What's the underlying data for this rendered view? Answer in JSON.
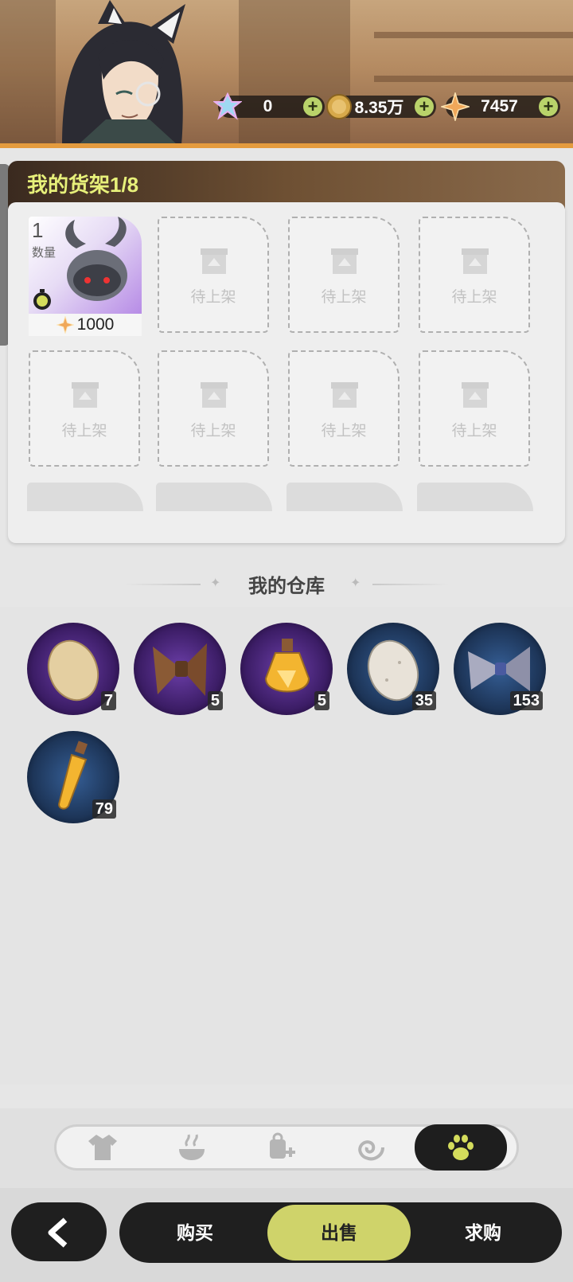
{
  "header": {
    "currencies": [
      {
        "icon": "crystal-icon",
        "value": "0"
      },
      {
        "icon": "gold-coin-icon",
        "value": "8.35万"
      },
      {
        "icon": "star-shard-icon",
        "value": "7457"
      }
    ],
    "plus_label": "+"
  },
  "shelf": {
    "title": "我的货架1/8",
    "listed_item": {
      "quantity": "1",
      "quantity_label": "数量",
      "price": "1000",
      "price_icon": "star-shard-icon"
    },
    "empty_slot_label": "待上架"
  },
  "warehouse": {
    "title": "我的仓库",
    "items": [
      {
        "icon": "egg-icon",
        "count": "7",
        "rarity": "purple"
      },
      {
        "icon": "hay-bundle-icon",
        "count": "5",
        "rarity": "purple"
      },
      {
        "icon": "potion-bottle-icon",
        "count": "5",
        "rarity": "purple"
      },
      {
        "icon": "speckled-egg-icon",
        "count": "35",
        "rarity": "blue"
      },
      {
        "icon": "feather-bundle-icon",
        "count": "153",
        "rarity": "blue"
      },
      {
        "icon": "vial-icon",
        "count": "79",
        "rarity": "blue"
      }
    ]
  },
  "category_tabs": [
    {
      "icon": "shirt-icon",
      "active": false
    },
    {
      "icon": "food-icon",
      "active": false
    },
    {
      "icon": "bag-icon",
      "active": false
    },
    {
      "icon": "swirl-icon",
      "active": false
    },
    {
      "icon": "paw-icon",
      "active": true
    }
  ],
  "bottom_bar": {
    "back_icon": "back-arrow-icon",
    "modes": [
      {
        "label": "购买",
        "active": false
      },
      {
        "label": "出售",
        "active": true
      },
      {
        "label": "求购",
        "active": false
      }
    ]
  },
  "colors": {
    "accent": "#cfd36a",
    "title_yellow": "#e7f07a",
    "purple_rarity": "#8f5bd6",
    "blue_rarity": "#4d8ee0"
  }
}
